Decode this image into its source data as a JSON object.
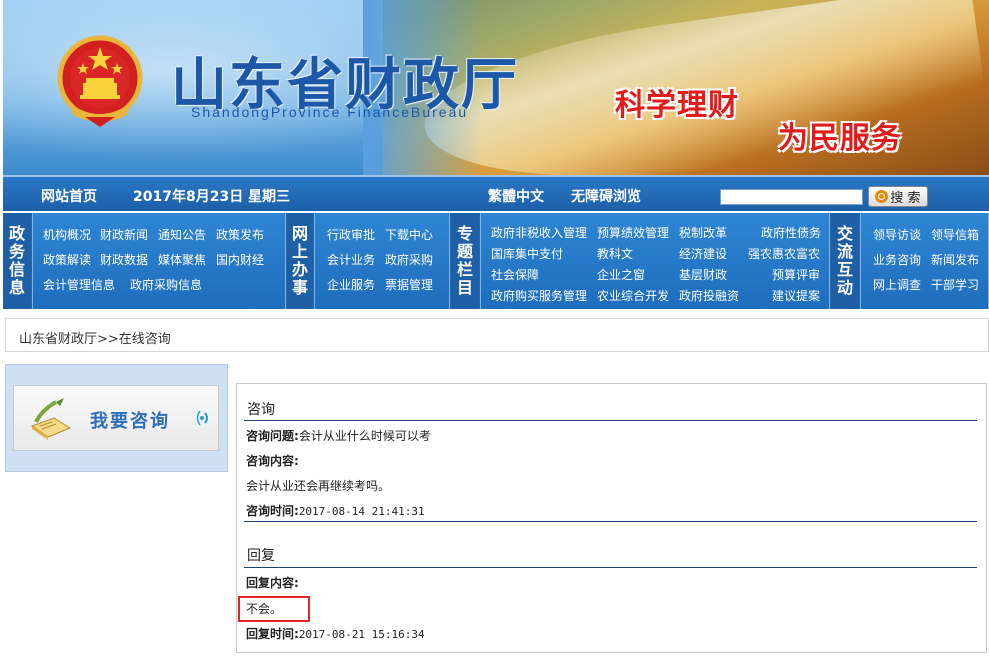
{
  "banner": {
    "title": "山东省财政厅",
    "subtitle": "ShandongProvince  FinanceBureau",
    "slogan_1": "科学理财",
    "slogan_2": "为民服务"
  },
  "topbar": {
    "home": "网站首页",
    "date": "2017年8月23日",
    "weekday": "星期三",
    "traditional": "繁體中文",
    "accessibility": "无障碍浏览",
    "search_value": "",
    "search_button": "搜 索"
  },
  "menu": {
    "cat_1": "政务信息",
    "group_1": [
      "机构概况",
      "财政新闻",
      "通知公告",
      "政策发布",
      "政策解读",
      "财政数据",
      "媒体聚焦",
      "国内财经",
      "会计管理信息",
      "政府采购信息"
    ],
    "cat_2": "网上办事",
    "group_2": [
      "行政审批",
      "下载中心",
      "会计业务",
      "政府采购",
      "企业服务",
      "票据管理"
    ],
    "cat_3": "专题栏目",
    "group_3": [
      "政府非税收入管理",
      "预算绩效管理",
      "税制改革",
      "政府性债务",
      "国库集中支付",
      "教科文",
      "经济建设",
      "强农惠农富农",
      "社会保障",
      "企业之窗",
      "基层财政",
      "预算评审",
      "政府购买服务管理",
      "农业综合开发",
      "政府投融资",
      "建议提案"
    ],
    "cat_4": "交流互动",
    "group_4": [
      "领导访谈",
      "领导信箱",
      "业务咨询",
      "新闻发布",
      "网上调查",
      "干部学习"
    ]
  },
  "breadcrumb": "山东省财政厅>>在线咨询",
  "left_panel": {
    "consult_label": "我要咨询"
  },
  "consult": {
    "section_title": "咨询",
    "question_label": "咨询问题:",
    "question_value": "会计从业什么时候可以考",
    "content_label": "咨询内容:",
    "content_value": "会计从业还会再继续考吗。",
    "time_label": "咨询时间:",
    "time_value": "2017-08-14 21:41:31"
  },
  "reply": {
    "section_title": "回复",
    "content_label": "回复内容:",
    "content_value": "不会。",
    "time_label": "回复时间:",
    "time_value": "2017-08-21 15:16:34"
  },
  "colors": {
    "nav_blue": "#1f68b4",
    "title_blue": "#1d58a8",
    "slogan_red": "#e11c1c",
    "highlight_red": "#e0262c"
  }
}
